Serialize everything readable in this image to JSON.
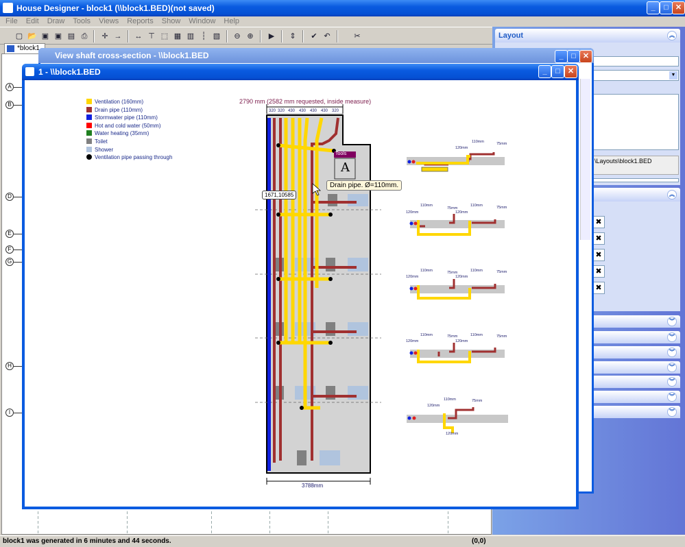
{
  "app": {
    "title": "House Designer - block1 (\\\\block1.BED)(not saved)",
    "menu": [
      "File",
      "Edit",
      "Draw",
      "Tools",
      "Views",
      "Reports",
      "Show",
      "Window",
      "Help"
    ],
    "doc_tab": "*block1",
    "status_text": "block1 was generated in 6 minutes and 44 seconds.",
    "status_coords": "(0,0)"
  },
  "shaft_window": {
    "title": "View shaft cross-section - \\\\block1.BED"
  },
  "inner_window": {
    "title": "1 - \\\\block1.BED"
  },
  "right_panel": {
    "layout_title": "Layout",
    "layout_path": "\\Layouts\\block1.BED"
  },
  "grid_markers": [
    "A",
    "B",
    "D",
    "E",
    "F",
    "G",
    "H",
    "I"
  ],
  "legend": [
    {
      "label": "Ventilation (160mm)",
      "color": "#ffd700"
    },
    {
      "label": "Drain pipe (110mm)",
      "color": "#a03030"
    },
    {
      "label": "Stormwater pipe (110mm)",
      "color": "#1020e0"
    },
    {
      "label": "Hot and cold water (50mm)",
      "color": "#ff0000"
    },
    {
      "label": "Water heating (35mm)",
      "color": "#208020"
    },
    {
      "label": "Toilet",
      "color": "#808080"
    },
    {
      "label": "Shower",
      "color": "#b0c4de"
    },
    {
      "label": "Ventilation pipe passing through",
      "color": "#000000"
    }
  ],
  "drawing": {
    "top_dimension": "2790 mm (2582 mm requested, inside measure)",
    "sub_dims": [
      "320",
      "320",
      "430",
      "430",
      "430",
      "430",
      "320"
    ],
    "bottom_dimension": "3788mm",
    "coord_tooltip": "1671,10585",
    "tools_label": "Tools",
    "tooltip": "Drain pipe. Ø=110mm."
  },
  "details": [
    {
      "labels": [
        "120mm",
        "110mm",
        "75mm"
      ]
    },
    {
      "labels": [
        "110mm",
        "75mm",
        "110mm",
        "75mm",
        "120mm",
        "120mm"
      ]
    },
    {
      "labels": [
        "110mm",
        "75mm",
        "110mm",
        "75mm",
        "120mm",
        "120mm"
      ]
    },
    {
      "labels": [
        "110mm",
        "75mm",
        "110mm",
        "75mm",
        "120mm",
        "120mm"
      ]
    },
    {
      "labels": [
        "120mm",
        "110mm",
        "75mm",
        "120mm"
      ]
    }
  ]
}
